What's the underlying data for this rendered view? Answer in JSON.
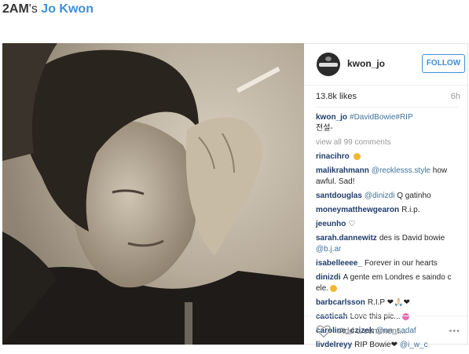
{
  "heading": {
    "group": "2AM",
    "possessive": "'s",
    "name": "Jo Kwon"
  },
  "post": {
    "username": "kwon_jo",
    "follow_label": "FOLLOW",
    "likes": "13.8k likes",
    "time": "6h",
    "caption": {
      "user": "kwon_jo",
      "text": "#DavidBowie#RIP",
      "line2": "전설-"
    },
    "view_all": "view all 99 comments",
    "comments": [
      {
        "user": "rinacihro",
        "text": "",
        "emoji": "#f2b630"
      },
      {
        "user": "malikrahmann",
        "mention": "@recklesss.style",
        "text": "how awful. Sad!"
      },
      {
        "user": "santdouglas",
        "mention": "@dinizdi",
        "text": "Q gatinho"
      },
      {
        "user": "moneymatthewgearon",
        "text": "R.i.p."
      },
      {
        "user": "jeeunho",
        "text": "♡"
      },
      {
        "user": "sarah.dannewitz",
        "text": "des is David bowie",
        "mention_after": "@b.j.ar"
      },
      {
        "user": "isabelleeee_",
        "text": "Forever in our hearts"
      },
      {
        "user": "dinizdi",
        "text": "A gente em Londres e saindo c ele.",
        "emoji": "#f2b630"
      },
      {
        "user": "barbcarlsson",
        "text": "R.I.P ❤🙏🏻❤",
        "emoji": ""
      },
      {
        "user": "caoticah",
        "text": "Love this pic...",
        "emoji": "#e66bb4"
      },
      {
        "user": "caroline_czizek",
        "mention": "@nn_sadaf",
        "text": ""
      },
      {
        "user": "livdelreyy",
        "text": "RIP Bowie❤",
        "mention_after": "@i_w_c"
      }
    ],
    "add_comment_placeholder": "Add a comment...",
    "more_label": "•••",
    "accent": "#3f8fd8"
  }
}
